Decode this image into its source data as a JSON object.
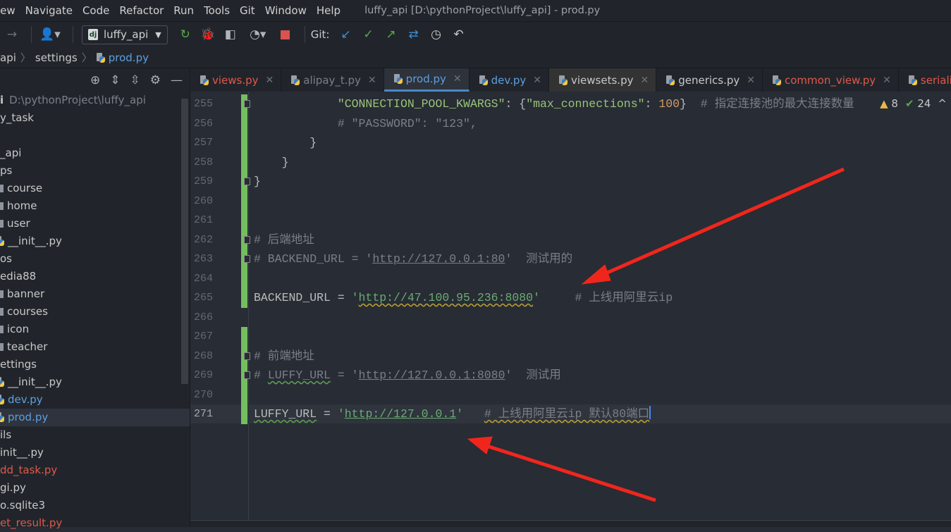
{
  "menu": {
    "items": [
      "iew",
      "Navigate",
      "Code",
      "Refactor",
      "Run",
      "Tools",
      "Git",
      "Window",
      "Help"
    ],
    "title": "luffy_api [D:\\pythonProject\\luffy_api] - prod.py"
  },
  "toolbar": {
    "run_config": "luffy_api",
    "git_label": "Git:"
  },
  "breadcrumb": [
    "api",
    "settings",
    "prod.py"
  ],
  "sidebar": {
    "items": [
      {
        "label": "i",
        "extra": "D:\\pythonProject\\luffy_api",
        "type": "root"
      },
      {
        "label": "y_task",
        "type": "plain"
      },
      {
        "label": "",
        "type": "plain"
      },
      {
        "label": "_api",
        "type": "plain"
      },
      {
        "label": "ps",
        "type": "plain"
      },
      {
        "label": "course",
        "type": "folder"
      },
      {
        "label": "home",
        "type": "folder"
      },
      {
        "label": "user",
        "type": "folder"
      },
      {
        "label": "__init__.py",
        "type": "py"
      },
      {
        "label": "os",
        "type": "plain"
      },
      {
        "label": "edia88",
        "type": "plain"
      },
      {
        "label": "banner",
        "type": "folder"
      },
      {
        "label": "courses",
        "type": "folder"
      },
      {
        "label": "icon",
        "type": "folder"
      },
      {
        "label": "teacher",
        "type": "folder"
      },
      {
        "label": "ettings",
        "type": "plain"
      },
      {
        "label": "__init__.py",
        "type": "py"
      },
      {
        "label": "dev.py",
        "type": "py",
        "color": "blue"
      },
      {
        "label": "prod.py",
        "type": "py",
        "color": "blue",
        "selected": true
      },
      {
        "label": "ils",
        "type": "plain"
      },
      {
        "label": "init__.py",
        "type": "plain"
      },
      {
        "label": "dd_task.py",
        "type": "plain",
        "color": "red"
      },
      {
        "label": "gi.py",
        "type": "plain"
      },
      {
        "label": "o.sqlite3",
        "type": "plain"
      },
      {
        "label": "et_result.py",
        "type": "plain",
        "color": "red"
      }
    ]
  },
  "tabs": [
    {
      "label": "views.py",
      "color": "red"
    },
    {
      "label": "alipay_t.py",
      "color": "dim"
    },
    {
      "label": "prod.py",
      "color": "blue",
      "active": true
    },
    {
      "label": "dev.py",
      "color": "blue"
    },
    {
      "label": "viewsets.py",
      "color": "",
      "hover": true
    },
    {
      "label": "generics.py",
      "color": ""
    },
    {
      "label": "common_view.py",
      "color": "red"
    },
    {
      "label": "serializer",
      "color": "red",
      "noclose": true
    }
  ],
  "inspections": {
    "warnings": "8",
    "weak": "24"
  },
  "code": [
    {
      "n": "255",
      "seg": [
        [
          "            ",
          "k"
        ],
        [
          "\"CONNECTION_POOL_KWARGS\"",
          "str"
        ],
        [
          ": {",
          "k"
        ],
        [
          "\"max_connections\"",
          "str"
        ],
        [
          ": ",
          "k"
        ],
        [
          "100",
          "n"
        ],
        [
          "}  ",
          "k"
        ],
        [
          "# 指定连接池的最大连接数量",
          "c"
        ]
      ],
      "chg": true,
      "fold": true
    },
    {
      "n": "256",
      "seg": [
        [
          "            ",
          "k"
        ],
        [
          "# \"PASSWORD\": \"123\",",
          "c"
        ]
      ],
      "chg": true
    },
    {
      "n": "257",
      "seg": [
        [
          "        }",
          "k"
        ]
      ],
      "chg": true
    },
    {
      "n": "258",
      "seg": [
        [
          "    }",
          "k"
        ]
      ],
      "chg": true
    },
    {
      "n": "259",
      "seg": [
        [
          "}",
          "k"
        ]
      ],
      "chg": true,
      "fold": true
    },
    {
      "n": "260",
      "seg": [],
      "chg": true
    },
    {
      "n": "261",
      "seg": [],
      "chg": true
    },
    {
      "n": "262",
      "seg": [
        [
          "# 后端地址",
          "c"
        ]
      ],
      "chg": true,
      "fold": true
    },
    {
      "n": "263",
      "seg": [
        [
          "# BACKEND_URL = '",
          "c"
        ],
        [
          "http://127.0.0.1:80",
          "c u"
        ],
        [
          "'  测试用的",
          "c"
        ]
      ],
      "chg": true,
      "fold": true
    },
    {
      "n": "264",
      "seg": [],
      "chg": true
    },
    {
      "n": "265",
      "seg": [
        [
          "BACKEND_URL = ",
          "k"
        ],
        [
          "'",
          "s"
        ],
        [
          "http://47.100.95.236:8080",
          "s u warn"
        ],
        [
          "'",
          "s"
        ],
        [
          "     # 上线用阿里云ip",
          "c"
        ]
      ],
      "chg": true
    },
    {
      "n": "266",
      "seg": []
    },
    {
      "n": "267",
      "seg": [],
      "chg": true
    },
    {
      "n": "268",
      "seg": [
        [
          "# 前端地址",
          "c"
        ]
      ],
      "chg": true,
      "fold": true
    },
    {
      "n": "269",
      "seg": [
        [
          "# ",
          "c"
        ],
        [
          "LUFFY_URL",
          "c warn-g"
        ],
        [
          " = '",
          "c"
        ],
        [
          "http://127.0.0.1:8080",
          "c u"
        ],
        [
          "'  测试用",
          "c"
        ]
      ],
      "chg": true,
      "fold": true
    },
    {
      "n": "270",
      "seg": [],
      "chg": true
    },
    {
      "n": "271",
      "seg": [
        [
          "LUFFY_URL",
          "k warn-g"
        ],
        [
          " = ",
          "k"
        ],
        [
          "'",
          "s"
        ],
        [
          "http://127.0.0.1",
          "s u"
        ],
        [
          "'",
          "s"
        ],
        [
          "   ",
          "k"
        ],
        [
          "# 上线用阿里云ip 默认80端口",
          "c warn"
        ]
      ],
      "chg": true,
      "current": true
    }
  ],
  "annotation_color": "#f0261c"
}
